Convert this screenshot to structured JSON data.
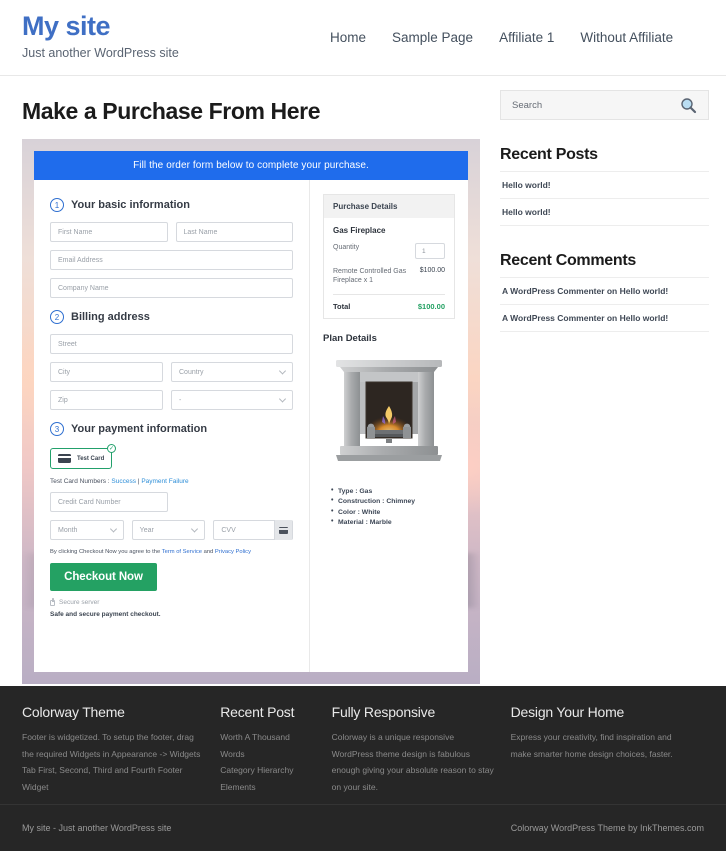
{
  "header": {
    "site_title": "My site",
    "tagline": "Just another WordPress site",
    "nav": [
      {
        "label": "Home"
      },
      {
        "label": "Sample Page"
      },
      {
        "label": "Affiliate 1"
      },
      {
        "label": "Without Affiliate"
      }
    ]
  },
  "main": {
    "page_title": "Make a Purchase From Here",
    "banner": "Fill the order form below to complete your purchase.",
    "steps": {
      "one_num": "1",
      "one_label": "Your basic information",
      "two_num": "2",
      "two_label": "Billing address",
      "three_num": "3",
      "three_label": "Your payment information"
    },
    "fields": {
      "first_name": "First Name",
      "last_name": "Last Name",
      "email": "Email Address",
      "company": "Company Name",
      "street": "Street",
      "city": "City",
      "country": "Country",
      "zip": "Zip",
      "state": "-",
      "credit_card": "Credit Card Number",
      "month": "Month",
      "year": "Year",
      "cvv": "CVV"
    },
    "payment": {
      "card_tab_label": "Test Card",
      "card_tab_check": "✓",
      "test_prefix": "Test Card Numbers : ",
      "test_success": "Success",
      "test_sep": " | ",
      "test_failure": "Payment Failure",
      "terms_pre": "By clicking Checkout Now you agree to the ",
      "terms_link1": "Term of Service",
      "terms_mid": " and ",
      "terms_link2": "Privacy Policy",
      "checkout_label": "Checkout Now",
      "secure_server": "Secure server",
      "safe_note": "Safe and secure payment checkout."
    },
    "purchase_details": {
      "heading": "Purchase Details",
      "product": "Gas Fireplace",
      "quantity_label": "Quantity",
      "quantity_value": "1",
      "line_item_label": "Remote Controlled Gas Fireplace x 1",
      "line_item_price": "$100.00",
      "total_label": "Total",
      "total_value": "$100.00"
    },
    "plan": {
      "title": "Plan Details",
      "specs": [
        "Type : Gas",
        "Construction : Chimney",
        "Color : White",
        "Material : Marble"
      ]
    }
  },
  "sidebar": {
    "search_placeholder": "Search",
    "recent_posts_title": "Recent Posts",
    "recent_posts": [
      "Hello world!",
      "Hello world!"
    ],
    "recent_comments_title": "Recent Comments",
    "recent_comments": [
      "A WordPress Commenter on Hello world!",
      "A WordPress Commenter on Hello world!"
    ]
  },
  "footer": {
    "columns": [
      {
        "title": "Colorway Theme",
        "text": "Footer is widgetized. To setup the footer, drag the required Widgets in Appearance -> Widgets Tab First, Second, Third and Fourth Footer Widget"
      },
      {
        "title": "Recent Post",
        "items": [
          "Worth A Thousand Words",
          "Category Hierarchy",
          "Elements"
        ]
      },
      {
        "title": "Fully Responsive",
        "text": "Colorway is a unique responsive WordPress theme design is fabulous enough giving your absolute reason to stay on your site."
      },
      {
        "title": "Design Your Home",
        "text": "Express your creativity, find inspiration and make smarter home design choices, faster."
      }
    ],
    "bottom_left": "My site - Just another WordPress site",
    "bottom_right": "Colorway WordPress Theme by InkThemes.com"
  },
  "colors": {
    "brand_blue": "#3f6fc4",
    "banner_blue": "#1f6cec",
    "accent_green": "#24a163",
    "footer_dark": "#262626"
  }
}
